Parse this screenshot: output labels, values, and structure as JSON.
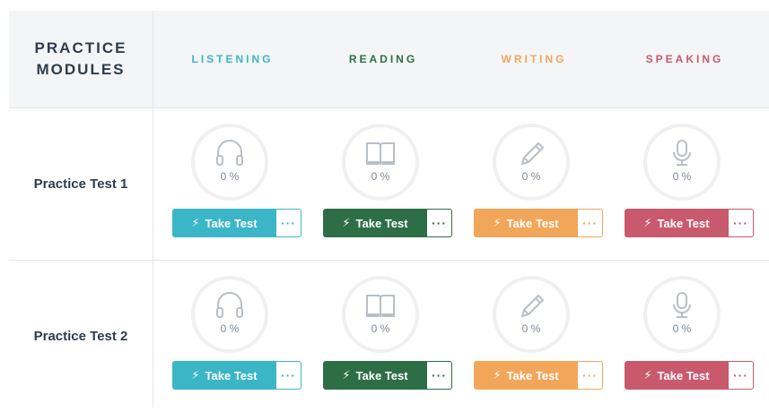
{
  "header": {
    "title_line1": "PRACTICE",
    "title_line2": "MODULES"
  },
  "modules": [
    {
      "label": "LISTENING",
      "color": "#3bb6c7",
      "icon": "headphones-icon"
    },
    {
      "label": "READING",
      "color": "#2e6e47",
      "icon": "book-icon"
    },
    {
      "label": "WRITING",
      "color": "#f2a65a",
      "icon": "pencil-icon"
    },
    {
      "label": "SPEAKING",
      "color": "#c95a6e",
      "icon": "microphone-icon"
    }
  ],
  "rows": [
    {
      "label": "Practice Test 1",
      "cells": [
        {
          "progress": "0 %",
          "button": "Take Test",
          "more": "···"
        },
        {
          "progress": "0 %",
          "button": "Take Test",
          "more": "···"
        },
        {
          "progress": "0 %",
          "button": "Take Test",
          "more": "···"
        },
        {
          "progress": "0 %",
          "button": "Take Test",
          "more": "···"
        }
      ]
    },
    {
      "label": "Practice Test 2",
      "cells": [
        {
          "progress": "0 %",
          "button": "Take Test",
          "more": "···"
        },
        {
          "progress": "0 %",
          "button": "Take Test",
          "more": "···"
        },
        {
          "progress": "0 %",
          "button": "Take Test",
          "more": "···"
        },
        {
          "progress": "0 %",
          "button": "Take Test",
          "more": "···"
        }
      ]
    }
  ]
}
